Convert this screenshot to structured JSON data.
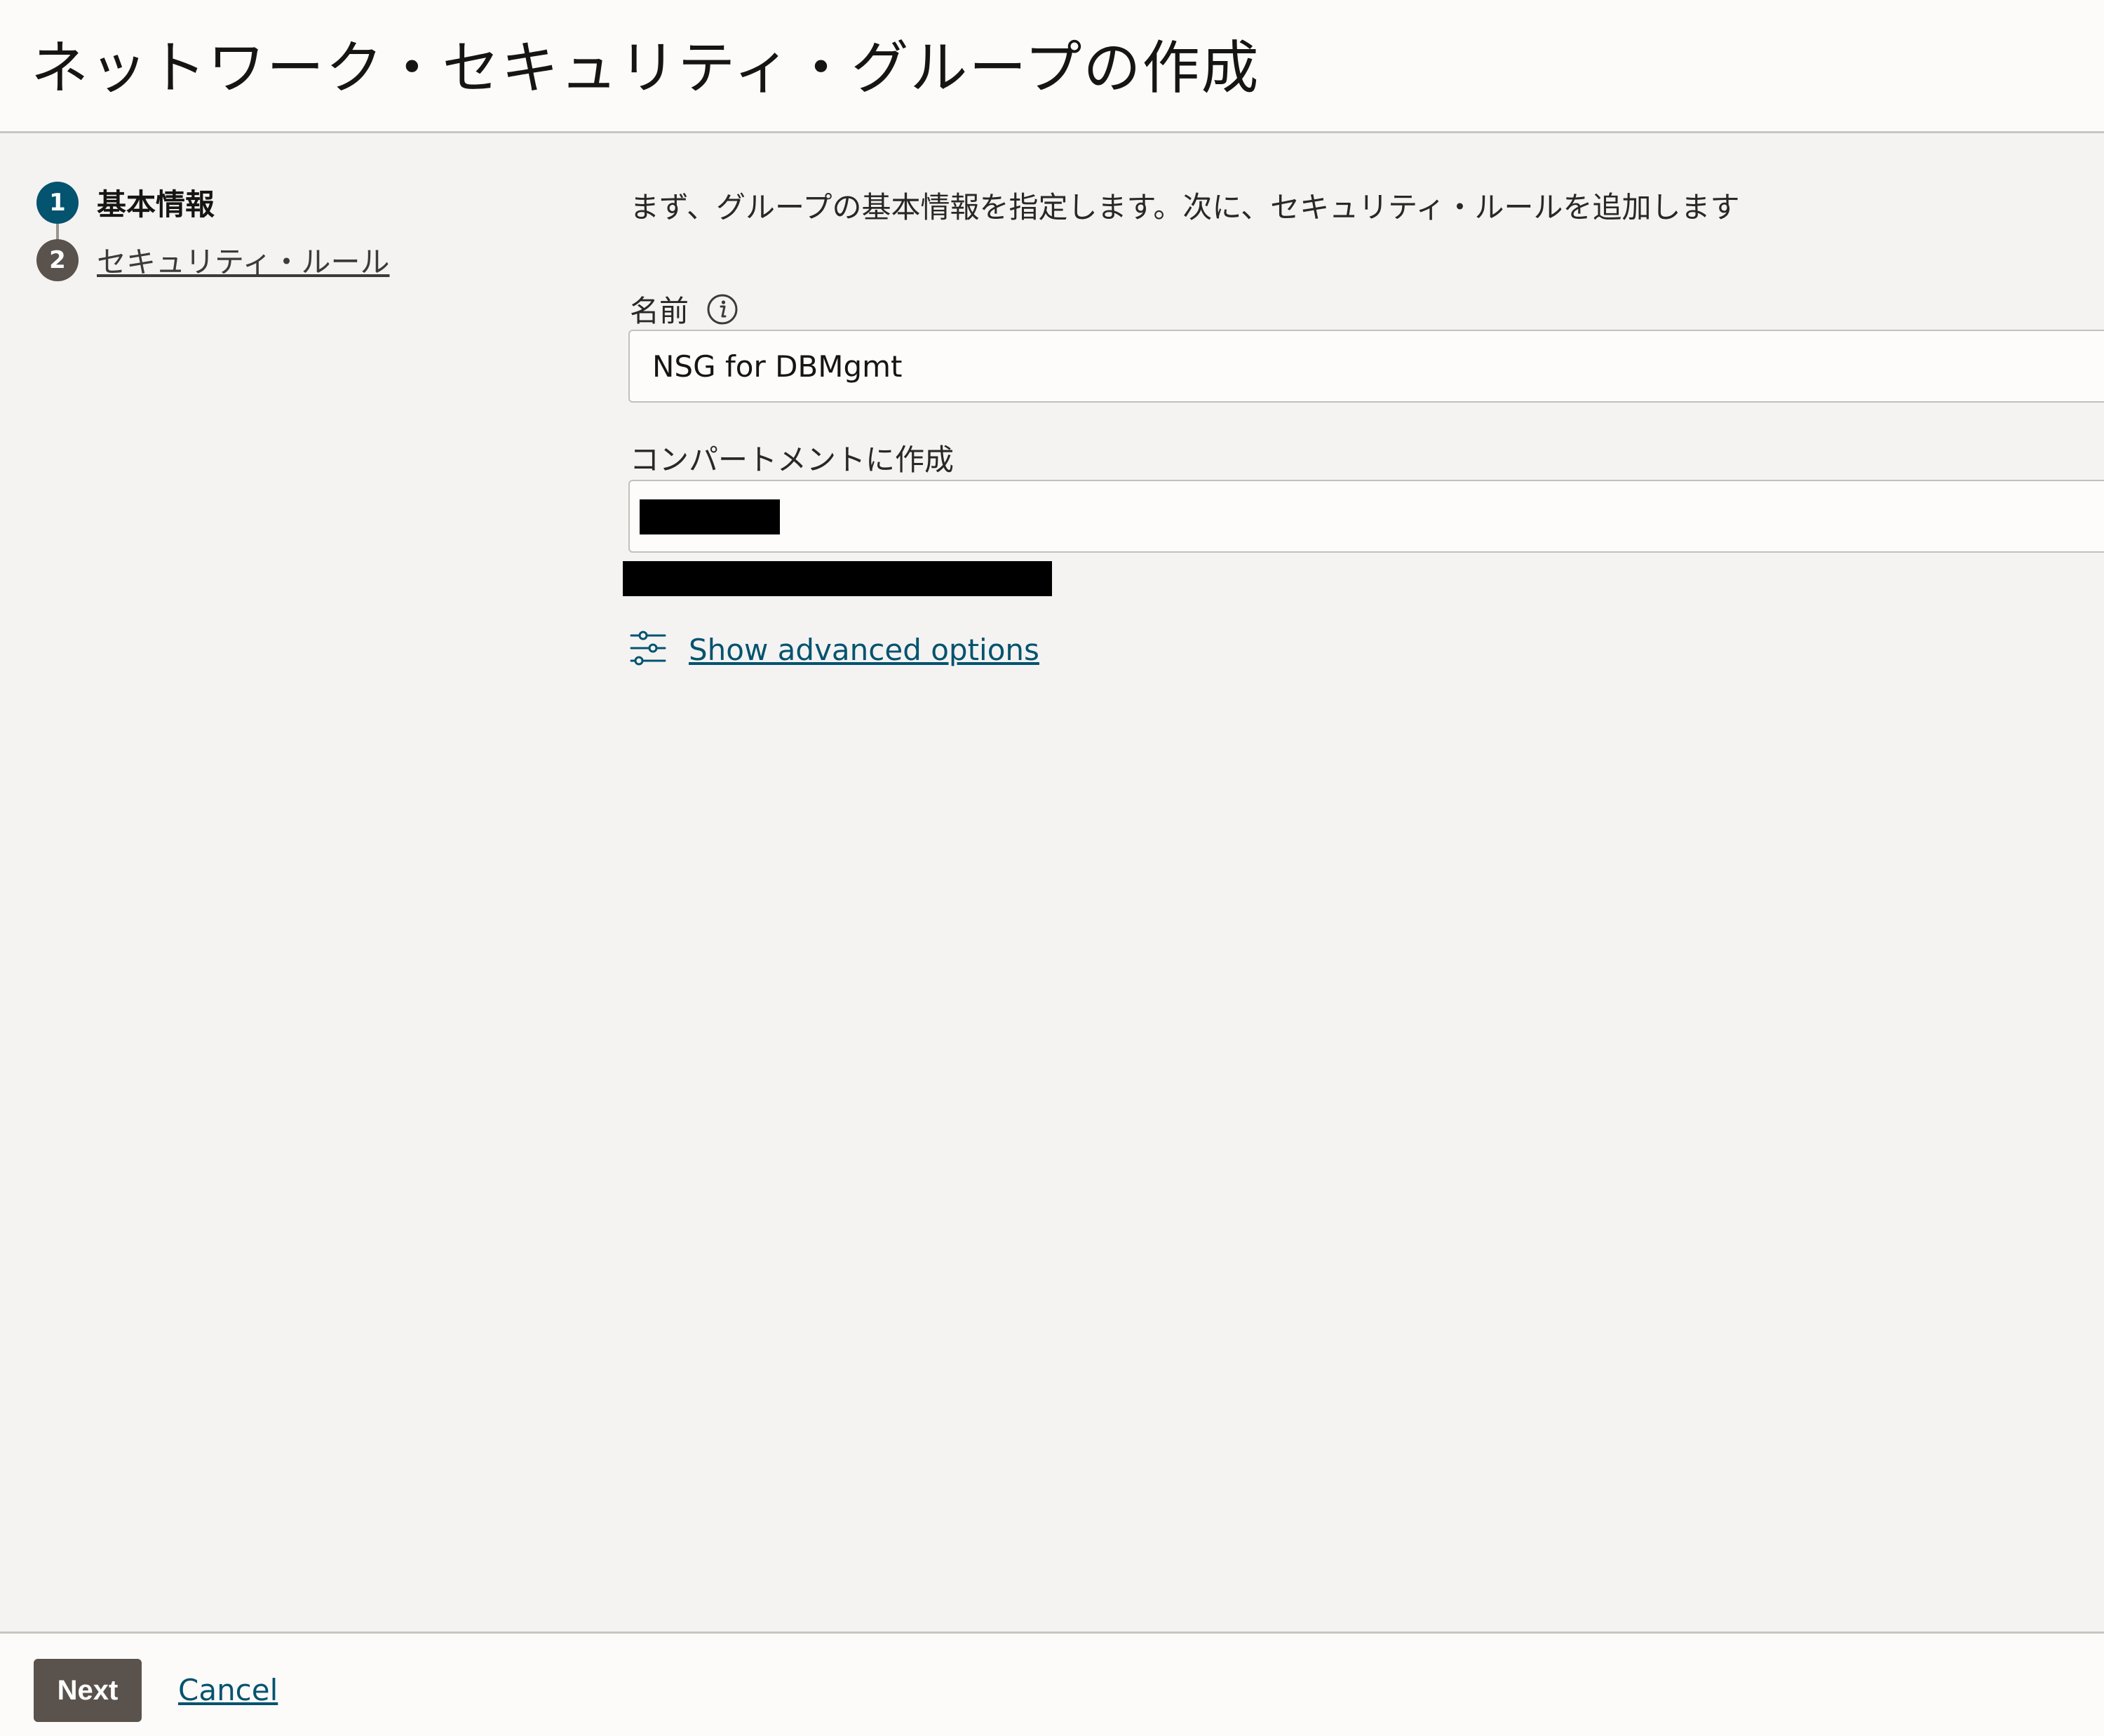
{
  "header": {
    "title": "ネットワーク・セキュリティ・グループの作成"
  },
  "steps": [
    {
      "number": "1",
      "label": "基本情報",
      "state": "current"
    },
    {
      "number": "2",
      "label": "セキュリティ・ルール",
      "state": "link"
    }
  ],
  "form": {
    "intro": "まず、グループの基本情報を指定します。次に、セキュリティ・ルールを追加します",
    "name_label": "名前",
    "name_value": "NSG for DBMgmt",
    "compartment_label": "コンパートメントに作成",
    "advanced_link": "Show advanced options"
  },
  "footer": {
    "next_label": "Next",
    "cancel_label": "Cancel"
  },
  "icons": {
    "info": "info-icon",
    "advanced": "sliders-icon"
  },
  "colors": {
    "accent": "#04536f",
    "button": "#5a524c",
    "background": "#f4f3f2"
  }
}
